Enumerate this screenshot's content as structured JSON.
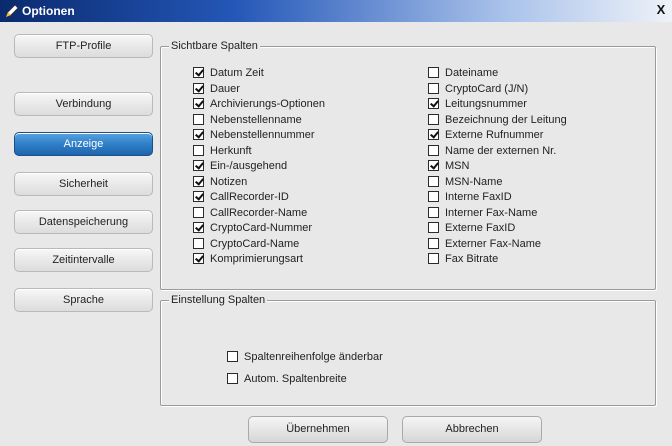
{
  "window": {
    "title": "Optionen",
    "close_glyph": "X"
  },
  "nav": [
    {
      "id": "ftp",
      "label": "FTP-Profile",
      "active": false
    },
    {
      "id": "verbindung",
      "label": "Verbindung",
      "active": false
    },
    {
      "id": "anzeige",
      "label": "Anzeige",
      "active": true
    },
    {
      "id": "sicherheit",
      "label": "Sicherheit",
      "active": false
    },
    {
      "id": "datenspeicherung",
      "label": "Datenspeicherung",
      "active": false
    },
    {
      "id": "zeitintervalle",
      "label": "Zeitintervalle",
      "active": false
    },
    {
      "id": "sprache",
      "label": "Sprache",
      "active": false
    }
  ],
  "visible_columns": {
    "title": "Sichtbare Spalten",
    "left": [
      {
        "label": "Datum Zeit",
        "checked": true
      },
      {
        "label": "Dauer",
        "checked": true
      },
      {
        "label": "Archivierungs-Optionen",
        "checked": true
      },
      {
        "label": "Nebenstellenname",
        "checked": false
      },
      {
        "label": "Nebenstellennummer",
        "checked": true
      },
      {
        "label": "Herkunft",
        "checked": false
      },
      {
        "label": "Ein-/ausgehend",
        "checked": true
      },
      {
        "label": "Notizen",
        "checked": true
      },
      {
        "label": "CallRecorder-ID",
        "checked": true
      },
      {
        "label": "CallRecorder-Name",
        "checked": false
      },
      {
        "label": "CryptoCard-Nummer",
        "checked": true
      },
      {
        "label": "CryptoCard-Name",
        "checked": false
      },
      {
        "label": "Komprimierungsart",
        "checked": true
      }
    ],
    "right": [
      {
        "label": "Dateiname",
        "checked": false
      },
      {
        "label": "CryptoCard (J/N)",
        "checked": false
      },
      {
        "label": "Leitungsnummer",
        "checked": true
      },
      {
        "label": "Bezeichnung der Leitung",
        "checked": false
      },
      {
        "label": "Externe Rufnummer",
        "checked": true
      },
      {
        "label": "Name der externen Nr.",
        "checked": false
      },
      {
        "label": "MSN",
        "checked": true
      },
      {
        "label": "MSN-Name",
        "checked": false
      },
      {
        "label": "Interne FaxID",
        "checked": false
      },
      {
        "label": "Interner Fax-Name",
        "checked": false
      },
      {
        "label": "Externe FaxID",
        "checked": false
      },
      {
        "label": "Externer Fax-Name",
        "checked": false
      },
      {
        "label": "Fax Bitrate",
        "checked": false
      }
    ]
  },
  "column_settings": {
    "title": "Einstellung Spalten",
    "options": [
      {
        "label": "Spaltenreihenfolge änderbar",
        "checked": false
      },
      {
        "label": "Autom. Spaltenbreite",
        "checked": false
      }
    ]
  },
  "buttons": {
    "apply": "Übernehmen",
    "cancel": "Abbrechen"
  }
}
